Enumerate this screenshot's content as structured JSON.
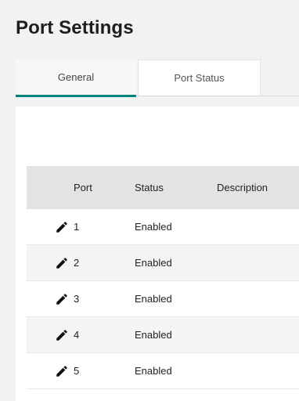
{
  "page": {
    "title": "Port Settings"
  },
  "tabs": [
    {
      "label": "General",
      "active": true
    },
    {
      "label": "Port Status",
      "active": false
    }
  ],
  "colors": {
    "accent": "#00857a",
    "header_bg": "#e3e3e3",
    "alt_row_bg": "#f4f4f4"
  },
  "table": {
    "headers": {
      "port": "Port",
      "status": "Status",
      "description": "Description"
    },
    "edit_icon": "pencil-icon",
    "rows": [
      {
        "port": "1",
        "status": "Enabled",
        "description": ""
      },
      {
        "port": "2",
        "status": "Enabled",
        "description": ""
      },
      {
        "port": "3",
        "status": "Enabled",
        "description": ""
      },
      {
        "port": "4",
        "status": "Enabled",
        "description": ""
      },
      {
        "port": "5",
        "status": "Enabled",
        "description": ""
      }
    ]
  }
}
